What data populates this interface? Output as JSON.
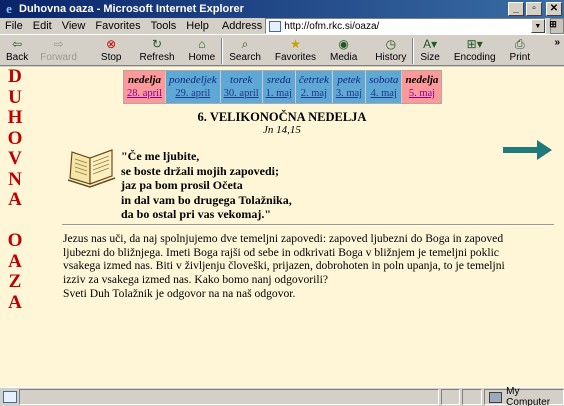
{
  "window": {
    "title": "Duhovna oaza - Microsoft Internet Explorer",
    "buttons": [
      "_",
      "▫",
      "✕"
    ]
  },
  "menu": [
    "File",
    "Edit",
    "View",
    "Favorites",
    "Tools",
    "Help"
  ],
  "address": {
    "label": "Address",
    "url": "http://ofm.rkc.si/oaza/"
  },
  "toolbar": {
    "back": "Back",
    "forward": "Forward",
    "stop": "Stop",
    "refresh": "Refresh",
    "home": "Home",
    "search": "Search",
    "favorites": "Favorites",
    "media": "Media",
    "history": "History",
    "size": "Size",
    "encoding": "Encoding",
    "print": "Print"
  },
  "page": {
    "sidebar_letters": [
      "D",
      "U",
      "H",
      "O",
      "V",
      "N",
      "A",
      "",
      "O",
      "A",
      "Z",
      "A"
    ],
    "days": [
      {
        "name": "nedelja",
        "date": "28. april",
        "type": "sun"
      },
      {
        "name": "ponedeljek",
        "date": "29. april",
        "type": "wk"
      },
      {
        "name": "torek",
        "date": "30. april",
        "type": "wk"
      },
      {
        "name": "sreda",
        "date": "1. maj",
        "type": "wk"
      },
      {
        "name": "četrtek",
        "date": "2. maj",
        "type": "wk"
      },
      {
        "name": "petek",
        "date": "3. maj",
        "type": "wk"
      },
      {
        "name": "sobota",
        "date": "4. maj",
        "type": "wk"
      },
      {
        "name": "nedelja",
        "date": "5. maj",
        "type": "sun"
      }
    ],
    "heading": "6. VELIKONOČNA NEDELJA",
    "reference": "Jn 14,15",
    "quote": [
      "\"Če me ljubite,",
      "se boste držali mojih zapovedi;",
      "jaz pa bom prosil Očeta",
      "in dal vam bo drugega Tolažnika,",
      "da bo ostal pri vas vekomaj.\""
    ],
    "body": [
      "Jezus nas uči, da naj spolnjujemo dve temeljni zapovedi: zapoved ljubezni do Boga in zapoved",
      "ljubezni do bližnjega. Imeti Boga rajši od sebe in odkrivati Boga v bližnjem je temeljni poklic",
      "vsakega izmed nas. Biti v življenju človeški, prijazen, dobrohoten in poln upanja, to je temeljni",
      "izziv za vsakega izmed nas. Kako bomo nanj odgovorili?",
      "Sveti Duh Tolažnik je odgovor na na naš odgovor."
    ]
  },
  "status": {
    "zone": "My Computer"
  },
  "colors": {
    "title_bar": "#0a246a",
    "page_bg": "#fff6d8",
    "sunday": "#ff9999",
    "weekday": "#5fa8d6",
    "sidebar_text": "#c00000",
    "arrow": "#1f7a7a"
  }
}
